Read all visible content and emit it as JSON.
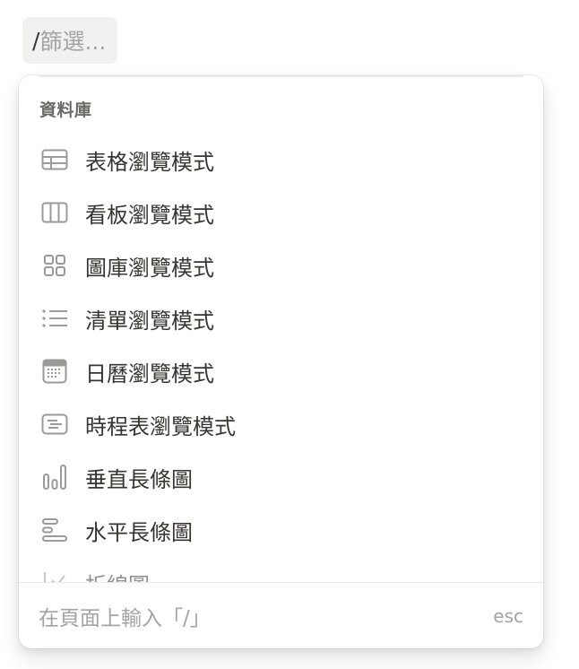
{
  "filter": {
    "slash": "/",
    "placeholder": "篩選..."
  },
  "menu": {
    "section_label": "資料庫",
    "items": [
      {
        "label": "表格瀏覽模式",
        "icon": "table-icon"
      },
      {
        "label": "看板瀏覽模式",
        "icon": "board-icon"
      },
      {
        "label": "圖庫瀏覽模式",
        "icon": "gallery-icon"
      },
      {
        "label": "清單瀏覽模式",
        "icon": "list-icon"
      },
      {
        "label": "日曆瀏覽模式",
        "icon": "calendar-icon"
      },
      {
        "label": "時程表瀏覽模式",
        "icon": "timeline-icon"
      },
      {
        "label": "垂直長條圖",
        "icon": "vertical-bar-chart-icon"
      },
      {
        "label": "水平長條圖",
        "icon": "horizontal-bar-chart-icon"
      },
      {
        "label": "折線圖",
        "icon": "line-chart-icon"
      }
    ],
    "footer_hint": "在頁面上輸入「/」",
    "footer_esc": "esc"
  },
  "colors": {
    "text": "#37352f",
    "icon": "#9b9a97",
    "muted": "#a5a4a0",
    "chip_bg": "#f1f1ef"
  }
}
